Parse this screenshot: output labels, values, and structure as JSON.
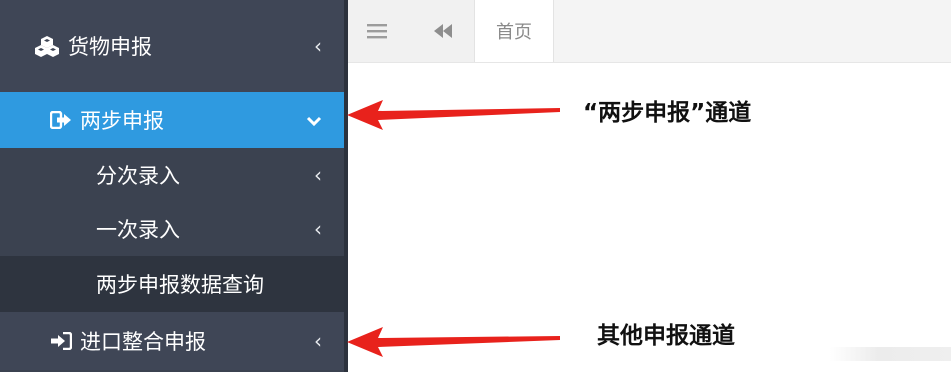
{
  "sidebar": {
    "items": [
      {
        "label": "货物申报",
        "icon": "cubes-icon",
        "chevron": "‹"
      },
      {
        "label": "两步申报",
        "icon": "sign-in-icon",
        "chevron": "⌄",
        "active": true
      },
      {
        "label": "分次录入",
        "chevron": "‹"
      },
      {
        "label": "一次录入",
        "chevron": "‹"
      },
      {
        "label": "两步申报数据查询"
      },
      {
        "label": "进口整合申报",
        "icon": "import-icon",
        "chevron": "‹"
      }
    ]
  },
  "topbar": {
    "menu_icon": "hamburger-icon",
    "back_icon": "double-left-icon",
    "tabs": [
      {
        "label": "首页"
      }
    ]
  },
  "annotations": {
    "two_step": "“两步申报”通道",
    "other": "其他申报通道",
    "arrow_color": "#e8221c"
  },
  "colors": {
    "sidebar_bg": "#3b4250",
    "active_bg": "#2f9ae0",
    "selected_sub_bg": "#2e343f"
  }
}
